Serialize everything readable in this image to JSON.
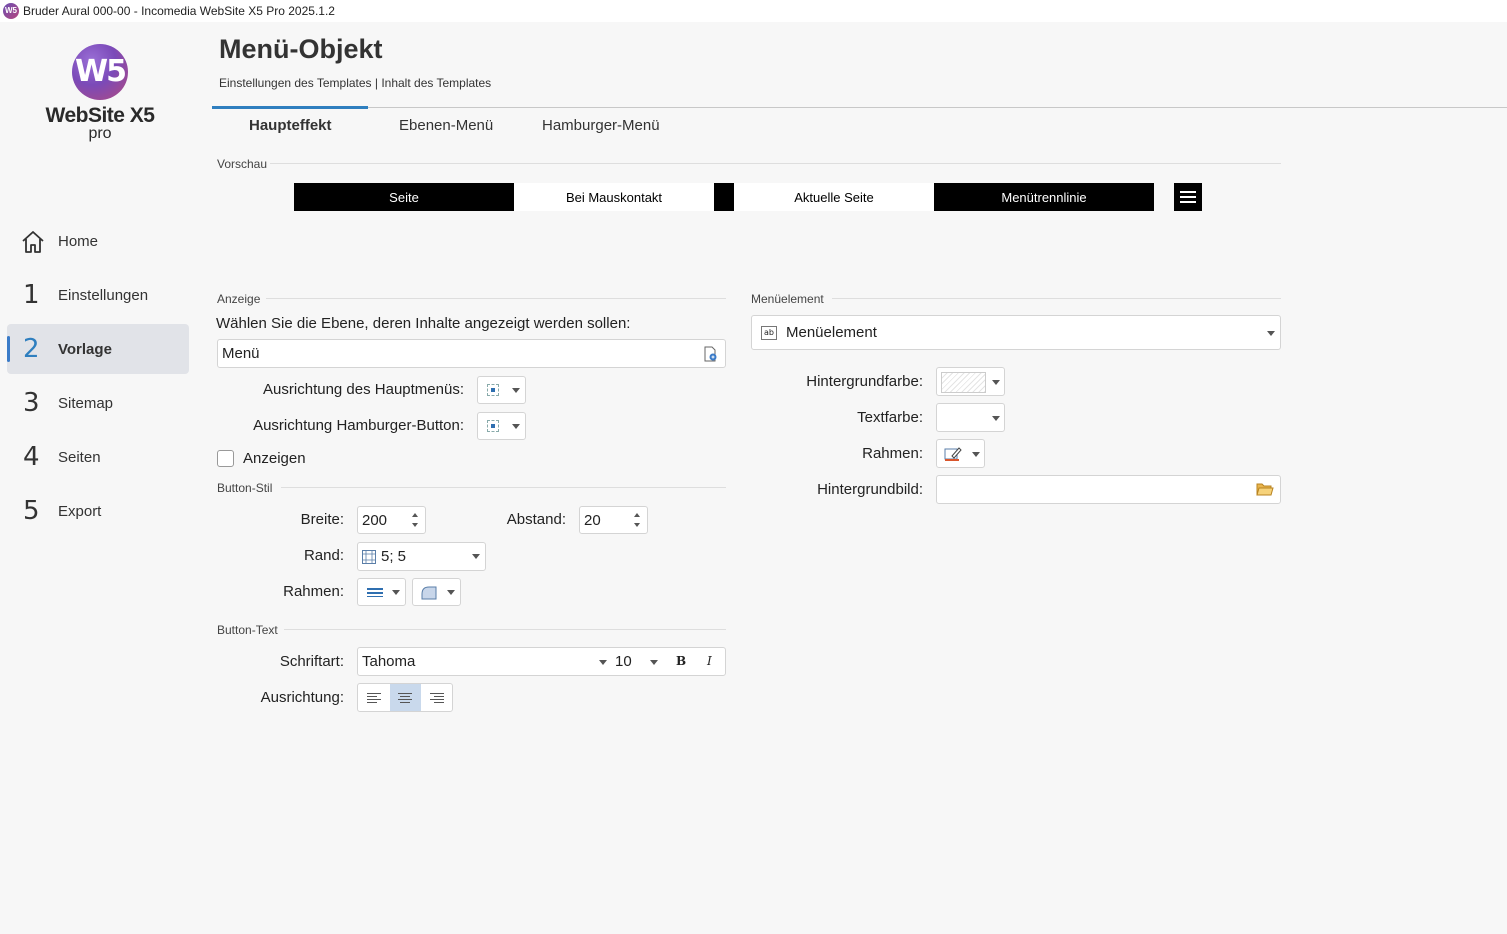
{
  "window": {
    "title": "Bruder Aural 000-00 - Incomedia WebSite X5 Pro 2025.1.2",
    "app_icon": "W5"
  },
  "logo": {
    "mark": "W5",
    "name": "WebSite X5",
    "edition": "pro"
  },
  "sidebar": {
    "items": [
      {
        "num": "",
        "icon": "home-icon",
        "label": "Home"
      },
      {
        "num": "1",
        "label": "Einstellungen"
      },
      {
        "num": "2",
        "label": "Vorlage",
        "active": true
      },
      {
        "num": "3",
        "label": "Sitemap"
      },
      {
        "num": "4",
        "label": "Seiten"
      },
      {
        "num": "5",
        "label": "Export"
      }
    ]
  },
  "header": {
    "title": "Menü-Objekt",
    "breadcrumb": "Einstellungen des Templates | Inhalt des Templates"
  },
  "tabs": [
    "Haupteffekt",
    "Ebenen-Menü",
    "Hamburger-Menü"
  ],
  "preview": {
    "label": "Vorschau",
    "items": [
      "Seite",
      "Bei Mauskontakt",
      "Aktuelle Seite",
      "Menütrennlinie"
    ]
  },
  "anzeige": {
    "label": "Anzeige",
    "prompt": "Wählen Sie die Ebene, deren Inhalte angezeigt werden sollen:",
    "level_value": "Menü",
    "main_align_label": "Ausrichtung des Hauptmenüs:",
    "hamburger_align_label": "Ausrichtung Hamburger-Button:",
    "show_label": "Anzeigen",
    "show_checked": false
  },
  "button_style": {
    "label": "Button-Stil",
    "width_label": "Breite:",
    "width_value": "200",
    "spacing_label": "Abstand:",
    "spacing_value": "20",
    "margin_label": "Rand:",
    "margin_value": "5; 5",
    "border_label": "Rahmen:"
  },
  "button_text": {
    "label": "Button-Text",
    "font_label": "Schriftart:",
    "font_value": "Tahoma",
    "size_value": "10",
    "bold": "B",
    "italic": "I",
    "align_label": "Ausrichtung:",
    "align_selected": "center"
  },
  "menu_element": {
    "label": "Menüelement",
    "select_value": "Menüelement",
    "select_icon": "ab",
    "bg_color_label": "Hintergrundfarbe:",
    "text_color_label": "Textfarbe:",
    "border_label": "Rahmen:",
    "bg_image_label": "Hintergrundbild:",
    "bg_image_value": ""
  },
  "colors": {
    "accent": "#2f7fbf",
    "preview_dark": "#000000",
    "preview_light": "#ffffff"
  }
}
